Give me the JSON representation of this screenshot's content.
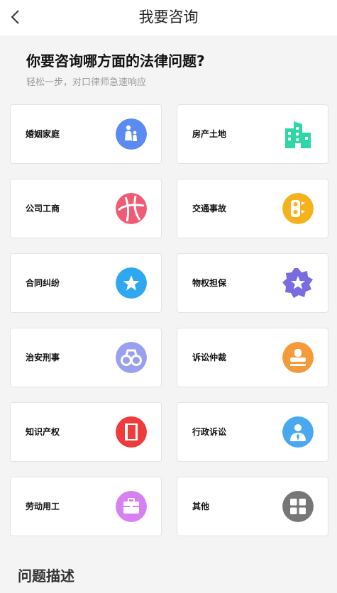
{
  "header": {
    "title": "我要咨询"
  },
  "intro": {
    "heading": "你要咨询哪方面的法律问题?",
    "subtitle": "轻松一步，对口律师急速响应"
  },
  "categories": [
    {
      "label": "婚姻家庭",
      "icon": "family-icon",
      "color": "#5a8bf0"
    },
    {
      "label": "房产土地",
      "icon": "building-icon",
      "color": "#2fd6a7"
    },
    {
      "label": "公司工商",
      "icon": "globe-icon",
      "color": "#f05a72"
    },
    {
      "label": "交通事故",
      "icon": "traffic-light-icon",
      "color": "#f6b21c"
    },
    {
      "label": "合同纠纷",
      "icon": "star-icon",
      "color": "#2fa8f0"
    },
    {
      "label": "物权担保",
      "icon": "badge-star-icon",
      "color": "#7a6ce0"
    },
    {
      "label": "治安刑事",
      "icon": "handcuffs-icon",
      "color": "#9aa0f0"
    },
    {
      "label": "诉讼仲裁",
      "icon": "stamp-icon",
      "color": "#f49a3a"
    },
    {
      "label": "知识产权",
      "icon": "book-icon",
      "color": "#ee3b3b"
    },
    {
      "label": "行政诉讼",
      "icon": "official-icon",
      "color": "#4aa8ee"
    },
    {
      "label": "劳动用工",
      "icon": "briefcase-icon",
      "color": "#d680f2"
    },
    {
      "label": "其他",
      "icon": "grid-icon",
      "color": "#767676"
    }
  ],
  "description": {
    "title": "问题描述"
  }
}
